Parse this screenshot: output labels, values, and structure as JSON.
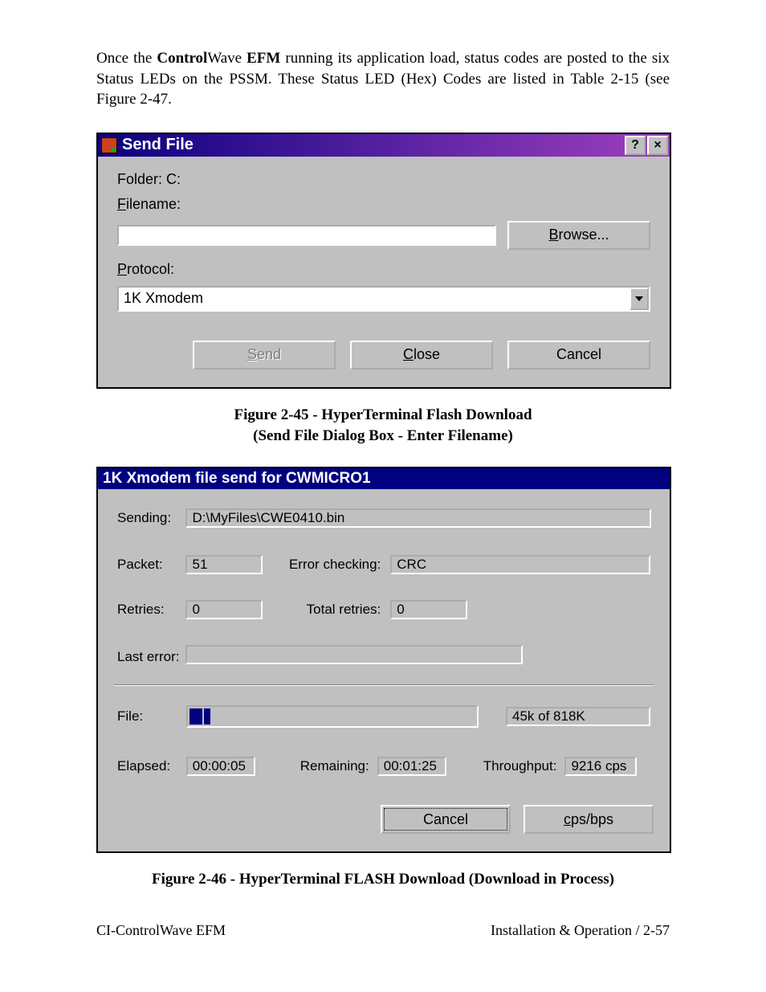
{
  "paragraph": {
    "pre": "Once the ",
    "b1": "Control",
    "mid1": "Wave ",
    "b2": "EFM",
    "rest": " running its application load, status codes are posted to the six Status LEDs on the PSSM. These Status LED (Hex) Codes are listed in Table 2-15 (see Figure 2-47."
  },
  "dialog1": {
    "title": "Send File",
    "help_glyph": "?",
    "close_glyph": "×",
    "folder_label": "Folder: C:",
    "filename_label_u": "F",
    "filename_label_rest": "ilename:",
    "filename_value": "",
    "browse_u": "B",
    "browse_rest": "rowse...",
    "protocol_label_u": "P",
    "protocol_label_rest": "rotocol:",
    "protocol_value": "1K Xmodem",
    "send_u": "S",
    "send_rest": "end",
    "close_u": "C",
    "close_rest": "lose",
    "cancel_label": "Cancel"
  },
  "caption1_line1": "Figure 2-45 - HyperTerminal Flash Download",
  "caption1_line2": "(Send File Dialog Box - Enter Filename)",
  "dialog2": {
    "title": "1K Xmodem file send for CWMICRO1",
    "sending_label": "Sending:",
    "sending_value": "D:\\MyFiles\\CWE0410.bin",
    "packet_label": "Packet:",
    "packet_value": "51",
    "errchk_label": "Error checking:",
    "errchk_value": "CRC",
    "retries_label": "Retries:",
    "retries_value": "0",
    "totretries_label": "Total retries:",
    "totretries_value": "0",
    "lasterr_label": "Last error:",
    "lasterr_value": "",
    "file_label": "File:",
    "file_value": "45k of 818K",
    "elapsed_label": "Elapsed:",
    "elapsed_value": "00:00:05",
    "remaining_label": "Remaining:",
    "remaining_value": "00:01:25",
    "throughput_label": "Throughput:",
    "throughput_value": "9216 cps",
    "cancel_label": "Cancel",
    "cpsbps_u": "c",
    "cpsbps_rest": "ps/bps"
  },
  "caption2": "Figure 2-46 - HyperTerminal FLASH Download (Download in Process)",
  "footer_left": "CI-ControlWave EFM",
  "footer_right": "Installation & Operation / 2-57"
}
